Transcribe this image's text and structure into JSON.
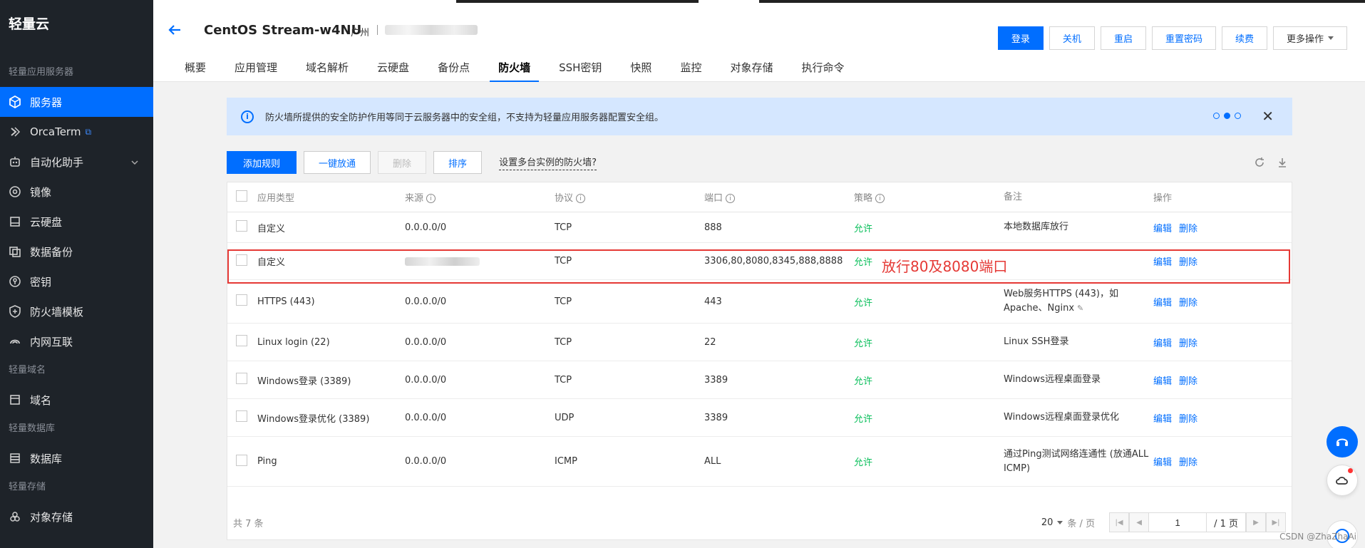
{
  "sidebar": {
    "brand": "轻量云",
    "section_servers": "轻量应用服务器",
    "items_a": [
      {
        "label": "服务器",
        "icon": "server-icon",
        "active": true
      },
      {
        "label": "OrcaTerm",
        "icon": "terminal-icon"
      },
      {
        "label": "自动化助手",
        "icon": "automation-icon"
      },
      {
        "label": "镜像",
        "icon": "image-icon"
      },
      {
        "label": "云硬盘",
        "icon": "disk-icon"
      },
      {
        "label": "数据备份",
        "icon": "backup-icon"
      },
      {
        "label": "密钥",
        "icon": "key-icon"
      },
      {
        "label": "防火墙模板",
        "icon": "shield-icon"
      },
      {
        "label": "内网互联",
        "icon": "network-icon"
      }
    ],
    "section_domain": "轻量域名",
    "domain_item": "域名",
    "section_db": "轻量数据库",
    "db_item": "数据库",
    "section_storage": "轻量存储",
    "storage_item": "对象存储"
  },
  "header": {
    "title": "CentOS Stream-w4NU",
    "region": "广州",
    "buttons": {
      "login": "登录",
      "shutdown": "关机",
      "restart": "重启",
      "reset_password": "重置密码",
      "renew": "续费",
      "more": "更多操作"
    },
    "tabs": [
      "概要",
      "应用管理",
      "域名解析",
      "云硬盘",
      "备份点",
      "防火墙",
      "SSH密钥",
      "快照",
      "监控",
      "对象存储",
      "执行命令"
    ],
    "active_tab": "防火墙"
  },
  "banner": {
    "text": "防火墙所提供的安全防护作用等同于云服务器中的安全组，不支持为轻量应用服务器配置安全组。"
  },
  "toolbar": {
    "add_rule": "添加规则",
    "allow_all": "一键放通",
    "delete": "删除",
    "sort": "排序",
    "multi_instance": "设置多台实例的防火墙?"
  },
  "table": {
    "headers": {
      "type": "应用类型",
      "source": "来源",
      "protocol": "协议",
      "port": "端口",
      "policy": "策略",
      "note": "备注",
      "op": "操作"
    },
    "rows": [
      {
        "type": "自定义",
        "source": "0.0.0.0/0",
        "protocol": "TCP",
        "port": "888",
        "policy": "允许",
        "note": "本地数据库放行",
        "edit": "编辑",
        "del": "删除"
      },
      {
        "type": "自定义",
        "source": "",
        "protocol": "TCP",
        "port": "3306,80,8080,8345,888,8888",
        "policy": "允许",
        "note": "",
        "edit": "编辑",
        "del": "删除"
      },
      {
        "type": "HTTPS (443)",
        "source": "0.0.0.0/0",
        "protocol": "TCP",
        "port": "443",
        "policy": "允许",
        "note": "Web服务HTTPS (443)，如Apache、Nginx",
        "edit": "编辑",
        "del": "删除"
      },
      {
        "type": "Linux login (22)",
        "source": "0.0.0.0/0",
        "protocol": "TCP",
        "port": "22",
        "policy": "允许",
        "note": "Linux SSH登录",
        "edit": "编辑",
        "del": "删除"
      },
      {
        "type": "Windows登录 (3389)",
        "source": "0.0.0.0/0",
        "protocol": "TCP",
        "port": "3389",
        "policy": "允许",
        "note": "Windows远程桌面登录",
        "edit": "编辑",
        "del": "删除"
      },
      {
        "type": "Windows登录优化 (3389)",
        "source": "0.0.0.0/0",
        "protocol": "UDP",
        "port": "3389",
        "policy": "允许",
        "note": "Windows远程桌面登录优化",
        "edit": "编辑",
        "del": "删除"
      },
      {
        "type": "Ping",
        "source": "0.0.0.0/0",
        "protocol": "ICMP",
        "port": "ALL",
        "policy": "允许",
        "note": "通过Ping测试网络连通性 (放通ALL ICMP)",
        "edit": "编辑",
        "del": "删除"
      }
    ],
    "total": "共 7 条",
    "page_size": "20",
    "page_size_unit": "条 / 页",
    "page": "1",
    "page_total": "/ 1 页"
  },
  "annotation": "放行80及8080端口",
  "watermark": "CSDN @ZhaZhaAi"
}
